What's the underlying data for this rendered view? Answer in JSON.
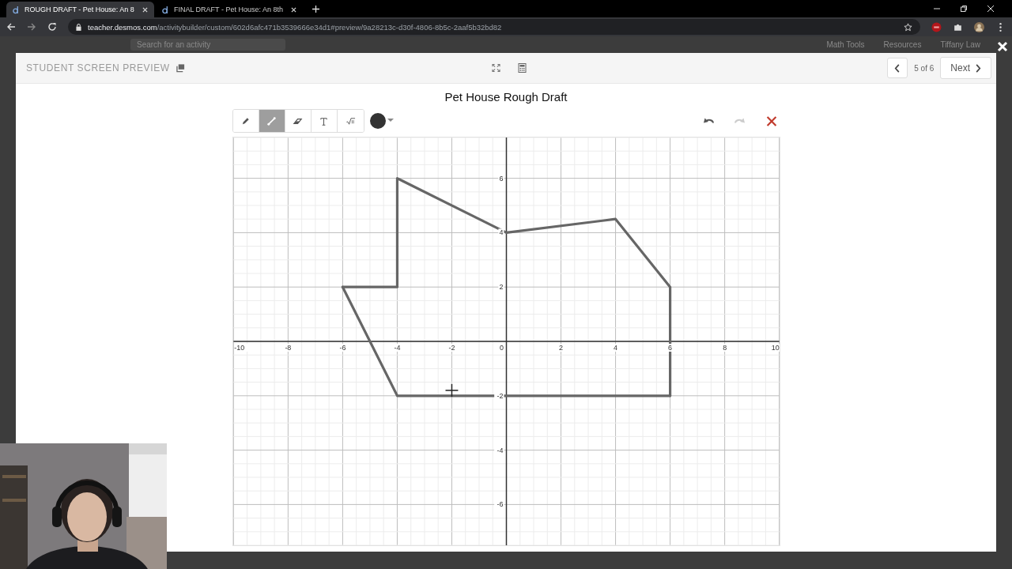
{
  "browser": {
    "tabs": [
      {
        "title": "ROUGH DRAFT - Pet House: An 8",
        "selected": true
      },
      {
        "title": "FINAL DRAFT - Pet House: An 8th",
        "selected": false
      }
    ],
    "url_host": "teacher.desmos.com",
    "url_path": "/activitybuilder/custom/602d6afc471b3539666e34d1#preview/9a28213c-d30f-4806-8b5c-2aaf5b32bd82"
  },
  "background_page": {
    "search_placeholder": "Search for an activity",
    "menus": [
      "Math Tools",
      "Resources",
      "Tiffany Law"
    ]
  },
  "preview": {
    "title": "STUDENT SCREEN PREVIEW",
    "page_indicator": "5 of 6",
    "next_label": "Next",
    "screen_title": "Pet House Rough Draft",
    "tools": [
      {
        "kind": "pencil",
        "selected": false
      },
      {
        "kind": "line",
        "selected": true
      },
      {
        "kind": "eraser",
        "selected": false
      },
      {
        "kind": "text",
        "selected": false
      },
      {
        "kind": "math",
        "selected": false
      }
    ],
    "undo": {
      "disabled": false
    },
    "redo": {
      "disabled": true
    },
    "sketch": {
      "chart_data": {
        "type": "line",
        "grid": true,
        "x": [
          -6,
          -4,
          -4,
          0,
          4,
          6,
          6,
          -6,
          -4,
          6
        ],
        "series": [
          {
            "color": "#666666",
            "values": [
              2,
              2,
              6,
              4,
              4.5,
              2,
              -2,
              null,
              null,
              null
            ]
          },
          {
            "color": "#666666",
            "values": [
              null,
              null,
              null,
              null,
              null,
              null,
              null,
              2,
              -2,
              -2
            ]
          }
        ],
        "xlim": [
          -10,
          10
        ],
        "ylim": [
          -7.5,
          7.5
        ],
        "xticks": [
          -10,
          -8,
          -6,
          -4,
          -2,
          0,
          2,
          4,
          6,
          8,
          10
        ],
        "yticks": [
          -6,
          -4,
          -2,
          2,
          4,
          6
        ]
      }
    }
  }
}
